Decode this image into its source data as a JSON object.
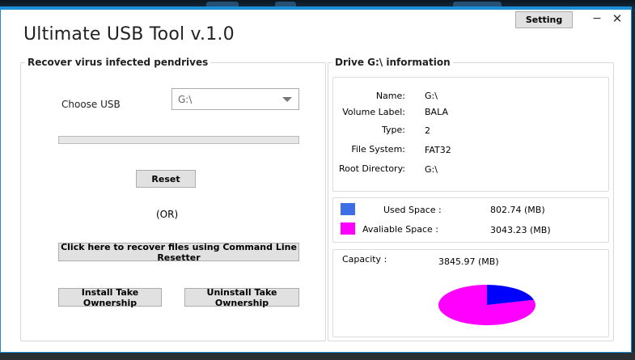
{
  "window": {
    "title": "Ultimate USB Tool v.1.0",
    "setting_label": "Setting",
    "minimize_glyph": "−",
    "close_glyph": "✕"
  },
  "recover": {
    "group_title": "Recover virus infected pendrives",
    "choose_label": "Choose USB",
    "selected_drive": "G:\\",
    "progress": 0,
    "reset_label": "Reset",
    "or_label": "(OR)",
    "cmd_label": "Click here to recover files using Command Line Resetter",
    "install_label": "Install Take Ownership",
    "uninstall_label": "Uninstall Take Ownership"
  },
  "drive_info": {
    "group_title": "Drive G:\\ information",
    "name_label": "Name:",
    "name_value": "G:\\",
    "volume_label": "Volume Label:",
    "volume_value": "BALA",
    "type_label": "Type:",
    "type_value": "2",
    "fs_label": "File System:",
    "fs_value": "FAT32",
    "root_label": "Root Directory:",
    "root_value": "G:\\"
  },
  "space": {
    "used_label": "Used Space :",
    "used_value": "802.74 (MB)",
    "used_color": "#3c6ee6",
    "avail_label": "Avaliable Space :",
    "avail_value": "3043.23 (MB)",
    "avail_color": "#ff00ff"
  },
  "capacity": {
    "label": "Capacity :",
    "value": "3845.97 (MB)",
    "used_mb": 802.74,
    "avail_mb": 3043.23,
    "used_pie_color": "#0000ff",
    "avail_pie_color": "#ff00ff"
  }
}
